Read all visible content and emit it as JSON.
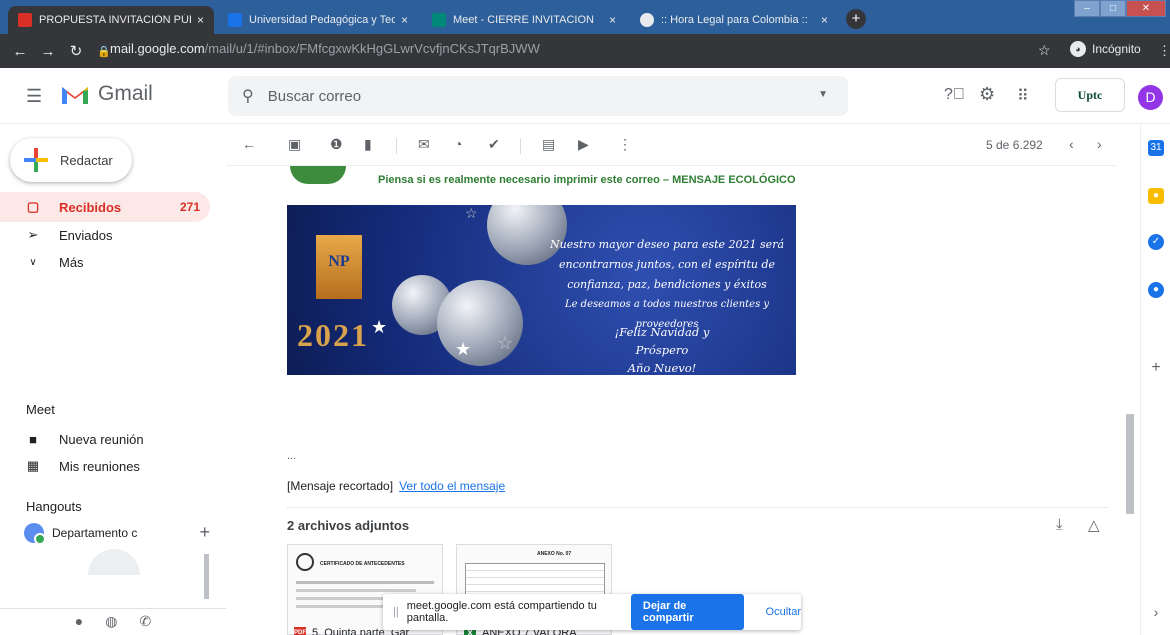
{
  "browser": {
    "tabs": [
      {
        "title": "PROPUESTA INVITACIÓN PÚBLIC",
        "favicon_color": "#d93025",
        "active": true
      },
      {
        "title": "Universidad Pedagógica y Tecnol",
        "favicon_color": "#1a73e8",
        "active": false
      },
      {
        "title": "Meet - CIERRE INVITACION",
        "favicon_color": "#00897b",
        "active": false
      },
      {
        "title": ":: Hora Legal para Colombia ::",
        "favicon_color": "#e8eaed",
        "active": false
      }
    ],
    "tab_close": "×",
    "new_tab": "+",
    "url_host": "mail.google.com",
    "url_path": "/mail/u/1/#inbox/FMfcgxwKkHgGLwrVcvfjnCKsJTqrBJWW",
    "profile_label": "Incógnito"
  },
  "gmail": {
    "app_name": "Gmail",
    "search_placeholder": "Buscar correo",
    "org_logo_text": "Uptc",
    "avatar_letter": "D"
  },
  "sidebar": {
    "compose_label": "Redactar",
    "items": [
      {
        "label": "Recibidos",
        "count": "271",
        "icon": "inbox-icon"
      },
      {
        "label": "Enviados",
        "count": "",
        "icon": "send-icon"
      },
      {
        "label": "Más",
        "count": "",
        "icon": "chevron-down-icon"
      }
    ],
    "meet_title": "Meet",
    "meet_items": [
      {
        "label": "Nueva reunión",
        "icon": "video-icon"
      },
      {
        "label": "Mis reuniones",
        "icon": "calendar-icon"
      }
    ],
    "hangouts_title": "Hangouts",
    "hangouts_contact": "Departamento c"
  },
  "toolbar": {
    "pager_text": "5 de 6.292"
  },
  "message": {
    "eco_notice": "Piensa si es realmente necesario imprimir este correo – MENSAJE ECOLÓGICO",
    "banner": {
      "logo_text": "NP",
      "year": "2021",
      "wish_line1": "Nuestro mayor deseo para este 2021 será",
      "wish_line2": "encontrarnos juntos, con el espíritu de",
      "wish_line3": "confianza, paz, bendiciones y éxitos",
      "wish_line4": "Le deseamos a todos nuestros clientes y proveedores",
      "greeting_line1": "¡Feliz Navidad y Próspero",
      "greeting_line2": "Año Nuevo!"
    },
    "ellipsis": "...",
    "trimmed_label": "[Mensaje recortado]",
    "view_all_link": "Ver todo el mensaje"
  },
  "attachments": {
    "title": "2 archivos adjuntos",
    "files": [
      {
        "name": "5. Quinta parte_Gar",
        "type_badge": "PDF",
        "badge_color": "#d93025"
      },
      {
        "name": "ANEXO 7 VALORA",
        "type_badge": "X",
        "badge_color": "#188038"
      }
    ],
    "doc1_heading": "CERTIFICADO DE ANTECEDENTES",
    "doc2_heading": "ANEXO No. 07"
  },
  "share_bar": {
    "message": "meet.google.com está compartiendo tu pantalla.",
    "stop_button": "Dejar de compartir",
    "hide_button": "Ocultar"
  }
}
